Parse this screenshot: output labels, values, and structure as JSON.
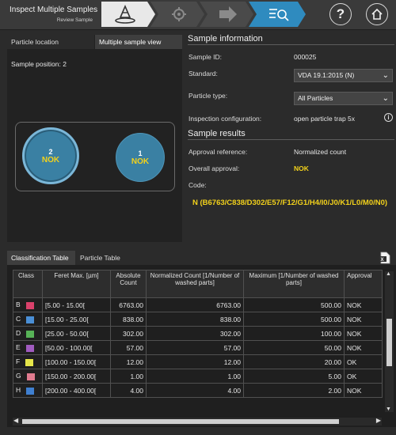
{
  "header": {
    "title": "Inspect Multiple Samples",
    "subtitle": "Review Sample",
    "steps": [
      {
        "icon": "microscope-icon",
        "state": "done"
      },
      {
        "icon": "gear-icon",
        "state": "inactive"
      },
      {
        "icon": "arrow-right-icon",
        "state": "inactive"
      },
      {
        "icon": "list-search-icon",
        "state": "active"
      }
    ],
    "help_icon": "question-icon",
    "home_icon": "home-icon"
  },
  "left_panel": {
    "tabs": [
      "Particle location",
      "Multiple sample view"
    ],
    "sample_position": "Sample position: 2",
    "samples": [
      {
        "number": "2",
        "status": "NOK"
      },
      {
        "number": "1",
        "status": "NOK"
      }
    ]
  },
  "sample_info": {
    "title": "Sample information",
    "sample_id_label": "Sample ID:",
    "sample_id": "000025",
    "standard_label": "Standard:",
    "standard": "VDA 19.1:2015 (N)",
    "particle_type_label": "Particle type:",
    "particle_type": "All Particles",
    "inspection_label": "Inspection configuration:",
    "inspection": "open particle trap 5x"
  },
  "sample_results": {
    "title": "Sample results",
    "approval_ref_label": "Approval reference:",
    "approval_ref": "Normalized count",
    "overall_label": "Overall approval:",
    "overall": "NOK",
    "code_label": "Code:",
    "code": "N (B6763/C838/D302/E57/F12/G1/H4/I0/J0/K1/L0/M0/N0)"
  },
  "bottom_tabs": [
    "Classification Table",
    "Particle Table"
  ],
  "table": {
    "headers": [
      "Class",
      "Feret Max. [µm]",
      "Absolute Count",
      "Normalized Count [1/Number of washed parts]",
      "Maximum [1/Number of washed parts]",
      "Approval"
    ],
    "rows": [
      {
        "cls": "B",
        "color": "#d9416b",
        "range": "[5.00 - 15.00[",
        "abs": "6763.00",
        "norm": "6763.00",
        "max": "500.00",
        "approval": "NOK"
      },
      {
        "cls": "C",
        "color": "#4a8fd6",
        "range": "[15.00 - 25.00[",
        "abs": "838.00",
        "norm": "838.00",
        "max": "500.00",
        "approval": "NOK"
      },
      {
        "cls": "D",
        "color": "#57b257",
        "range": "[25.00 - 50.00[",
        "abs": "302.00",
        "norm": "302.00",
        "max": "100.00",
        "approval": "NOK"
      },
      {
        "cls": "E",
        "color": "#a05bbf",
        "range": "[50.00 - 100.00[",
        "abs": "57.00",
        "norm": "57.00",
        "max": "50.00",
        "approval": "NOK"
      },
      {
        "cls": "F",
        "color": "#e6e64a",
        "range": "[100.00 - 150.00[",
        "abs": "12.00",
        "norm": "12.00",
        "max": "20.00",
        "approval": "OK"
      },
      {
        "cls": "G",
        "color": "#e07b8f",
        "range": "[150.00 - 200.00[",
        "abs": "1.00",
        "norm": "1.00",
        "max": "5.00",
        "approval": "OK"
      },
      {
        "cls": "H",
        "color": "#3f7fd0",
        "range": "[200.00 - 400.00[",
        "abs": "4.00",
        "norm": "4.00",
        "max": "2.00",
        "approval": "NOK"
      }
    ]
  }
}
